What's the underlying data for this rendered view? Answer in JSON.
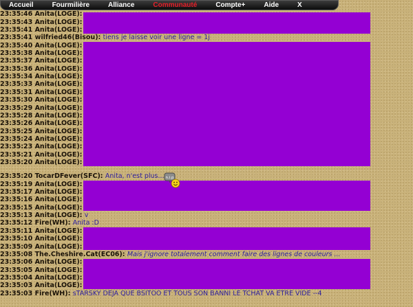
{
  "nav": {
    "items": [
      "Accueil",
      "Fourmilière",
      "Alliance",
      "Communauté",
      "Compte+",
      "Aide",
      "X"
    ],
    "active_index": 3,
    "active_color": "#e8202a"
  },
  "theme": {
    "background": "#c9b27a",
    "highlight_block": "#9400d3",
    "message_text": "#2a1c9e"
  },
  "chat": {
    "lines": [
      {
        "time": "23:35:46",
        "author": "Anita(LOGE):",
        "text": ""
      },
      {
        "time": "23:35:43",
        "author": "Anita(LOGE):",
        "text": ""
      },
      {
        "time": "23:35:41",
        "author": "Anita(LOGE):",
        "text": ""
      },
      {
        "time": "23:35:41",
        "author": "wilfried46(Bisou):",
        "text": "tiens je laisse voir une ligne = 1j"
      },
      {
        "time": "23:35:40",
        "author": "Anita(LOGE):",
        "text": ""
      },
      {
        "time": "23:35:38",
        "author": "Anita(LOGE):",
        "text": ""
      },
      {
        "time": "23:35:37",
        "author": "Anita(LOGE):",
        "text": ""
      },
      {
        "time": "23:35:36",
        "author": "Anita(LOGE):",
        "text": ""
      },
      {
        "time": "23:35:34",
        "author": "Anita(LOGE):",
        "text": ""
      },
      {
        "time": "23:35:33",
        "author": "Anita(LOGE):",
        "text": ""
      },
      {
        "time": "23:35:31",
        "author": "Anita(LOGE):",
        "text": ""
      },
      {
        "time": "23:35:30",
        "author": "Anita(LOGE):",
        "text": ""
      },
      {
        "time": "23:35:29",
        "author": "Anita(LOGE):",
        "text": ""
      },
      {
        "time": "23:35:28",
        "author": "Anita(LOGE):",
        "text": ""
      },
      {
        "time": "23:35:26",
        "author": "Anita(LOGE):",
        "text": ""
      },
      {
        "time": "23:35:25",
        "author": "Anita(LOGE):",
        "text": ""
      },
      {
        "time": "23:35:24",
        "author": "Anita(LOGE):",
        "text": ""
      },
      {
        "time": "23:35:23",
        "author": "Anita(LOGE):",
        "text": ""
      },
      {
        "time": "23:35:21",
        "author": "Anita(LOGE):",
        "text": ""
      },
      {
        "time": "23:35:20",
        "author": "Anita(LOGE):",
        "text": ""
      },
      {
        "time": "23:35:20",
        "author": "TocarDFever(SFC):",
        "text": "Anita, n'est plus..."
      },
      {
        "time": "23:35:19",
        "author": "Anita(LOGE):",
        "text": ""
      },
      {
        "time": "23:35:17",
        "author": "Anita(LOGE):",
        "text": ""
      },
      {
        "time": "23:35:16",
        "author": "Anita(LOGE):",
        "text": ""
      },
      {
        "time": "23:35:15",
        "author": "Anita(LOGE):",
        "text": ""
      },
      {
        "time": "23:35:13",
        "author": "Anita(LOGE):",
        "text": "v"
      },
      {
        "time": "23:35:12",
        "author": "Fire(WH):",
        "text": "Anita :D"
      },
      {
        "time": "23:35:11",
        "author": "Anita(LOGE):",
        "text": ""
      },
      {
        "time": "23:35:10",
        "author": "Anita(LOGE):",
        "text": ""
      },
      {
        "time": "23:35:09",
        "author": "Anita(LOGE):",
        "text": ""
      },
      {
        "time": "23:35:08",
        "author": "The.Cheshire.Cat(EC06):",
        "text": "Mais j'ignore totalement comment faire des lignes de couleurs ...",
        "italic": true
      },
      {
        "time": "23:35:06",
        "author": "Anita(LOGE):",
        "text": ""
      },
      {
        "time": "23:35:05",
        "author": "Anita(LOGE):",
        "text": ""
      },
      {
        "time": "23:35:04",
        "author": "Anita(LOGE):",
        "text": ""
      },
      {
        "time": "23:35:03",
        "author": "Anita(LOGE):",
        "text": ""
      },
      {
        "time": "23:35:03",
        "author": "Fire(WH):",
        "text": "sTARSKY DEJA QUE BSITOO ET TOUS SON BANNI LE TCHAT VA ETRE VIDE --4"
      }
    ]
  },
  "smiley": {
    "label": "n.i.p",
    "icon": "smiley-face-icon"
  }
}
